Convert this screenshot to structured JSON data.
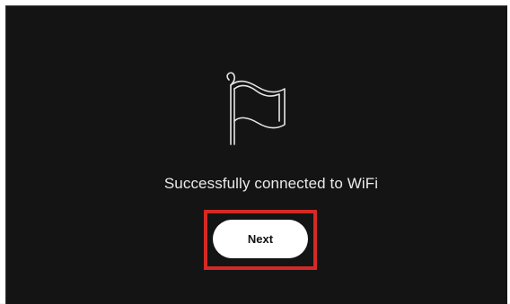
{
  "screen": {
    "message": "Successfully connected to WiFi",
    "icon": "flag-icon",
    "next_label": "Next"
  },
  "colors": {
    "background": "#141414",
    "text": "#eaeaea",
    "button_bg": "#ffffff",
    "highlight": "#d42a26"
  }
}
